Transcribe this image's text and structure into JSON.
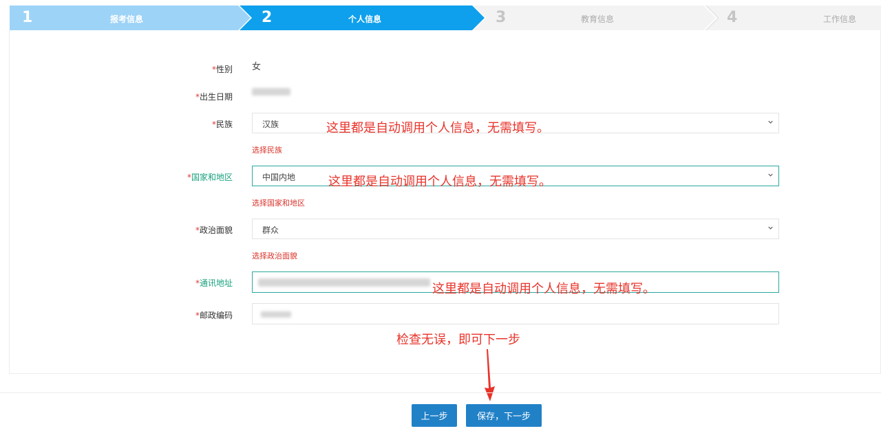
{
  "steps": [
    {
      "num": "1",
      "label": "报考信息"
    },
    {
      "num": "2",
      "label": "个人信息"
    },
    {
      "num": "3",
      "label": "教育信息"
    },
    {
      "num": "4",
      "label": "工作信息"
    }
  ],
  "form": {
    "required_mark": "*",
    "gender": {
      "label": "性别",
      "value": "女"
    },
    "birthdate": {
      "label": "出生日期"
    },
    "ethnicity": {
      "label": "民族",
      "value": "汉族",
      "hint": "选择民族"
    },
    "region": {
      "label": "国家和地区",
      "value": "中国内地",
      "hint": "选择国家和地区"
    },
    "political": {
      "label": "政治面貌",
      "value": "群众",
      "hint": "选择政治面貌"
    },
    "address": {
      "label": "通讯地址"
    },
    "postcode": {
      "label": "邮政编码"
    }
  },
  "annotations": {
    "auto_fill_note": "这里都是自动调用个人信息，无需填写。",
    "check_note": "检查无误，即可下一步"
  },
  "buttons": {
    "prev": "上一步",
    "next": "保存，下一步"
  },
  "colors": {
    "step_done": "#9dd3f7",
    "step_active": "#0ea0ec",
    "step_pending": "#f3f3f3",
    "required": "#e03a3a",
    "annotation": "#e8332a",
    "button": "#2181c7"
  }
}
